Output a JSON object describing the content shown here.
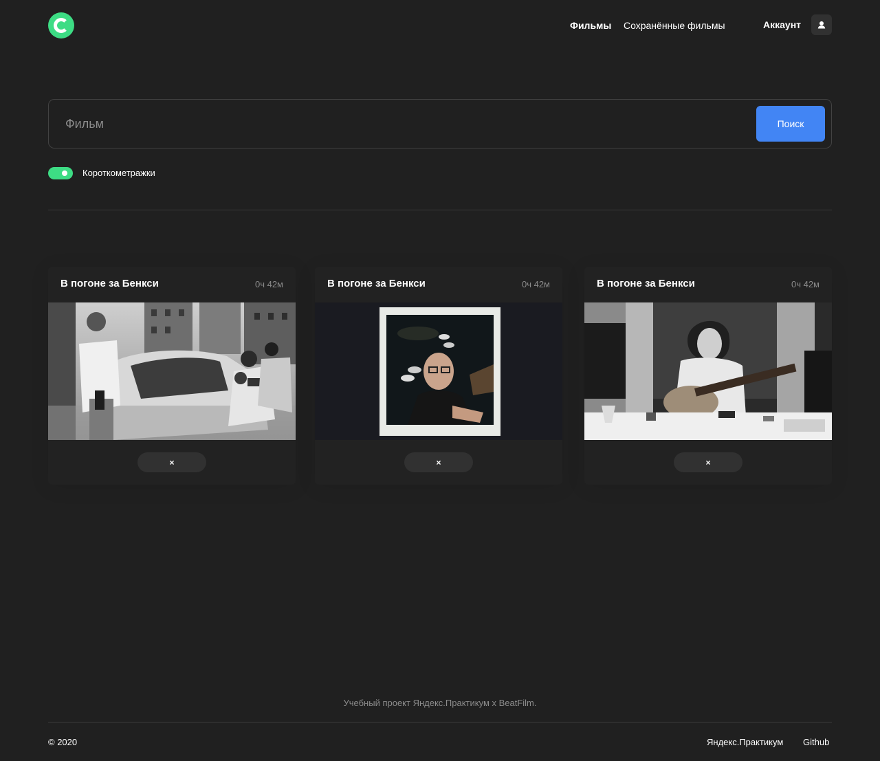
{
  "header": {
    "nav": [
      {
        "label": "Фильмы"
      },
      {
        "label": "Сохранённые фильмы"
      }
    ],
    "account_label": "Аккаунт"
  },
  "search": {
    "placeholder": "Фильм",
    "value": "",
    "button_label": "Поиск"
  },
  "filter": {
    "shorts_label": "Короткометражки",
    "shorts_enabled": true
  },
  "cards": [
    {
      "title": "В погоне за Бенкси",
      "duration": "0ч 42м",
      "remove_label": "×"
    },
    {
      "title": "В погоне за Бенкси",
      "duration": "0ч 42м",
      "remove_label": "×"
    },
    {
      "title": "В погоне за Бенкси",
      "duration": "0ч 42м",
      "remove_label": "×"
    }
  ],
  "footer": {
    "note": "Учебный проект Яндекс.Практикум х BeatFilm.",
    "copyright": "© 2020",
    "links": [
      {
        "label": "Яндекс.Практикум"
      },
      {
        "label": "Github"
      }
    ]
  },
  "colors": {
    "background": "#202020",
    "accent_green": "#3ddc84",
    "accent_blue": "#4285f4",
    "muted_text": "#8b8b8b"
  }
}
